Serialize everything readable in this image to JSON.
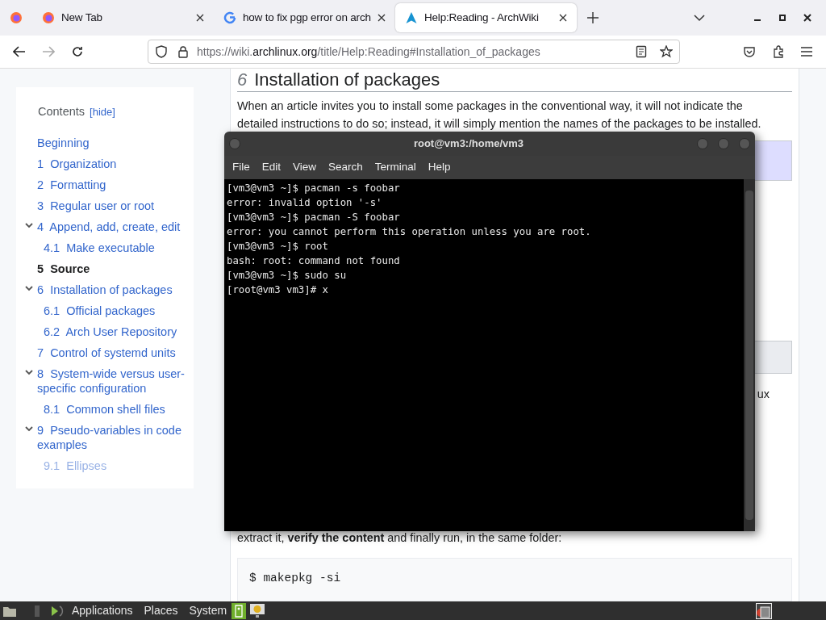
{
  "browser": {
    "tabs": [
      {
        "title": "New Tab",
        "selected": false
      },
      {
        "title": "how to fix pgp error on arch",
        "selected": false
      },
      {
        "title": "Help:Reading - ArchWiki",
        "selected": true
      }
    ],
    "url": {
      "prefix": "https://wiki.",
      "domain": "archlinux.org",
      "suffix": "/title/Help:Reading#Installation_of_packages"
    }
  },
  "toc": {
    "title": "Contents",
    "toggle": "[hide]",
    "items": [
      {
        "label": "Beginning",
        "current": false
      },
      {
        "number": "1",
        "label": "Organization",
        "current": false
      },
      {
        "number": "2",
        "label": "Formatting",
        "current": false
      },
      {
        "number": "3",
        "label": "Regular user or root",
        "current": false
      },
      {
        "number": "4",
        "label": "Append, add, create, edit",
        "current": false,
        "expanded": true,
        "children": [
          {
            "number": "4.1",
            "label": "Make executable",
            "current": false
          }
        ]
      },
      {
        "number": "5",
        "label": "Source",
        "current": true
      },
      {
        "number": "6",
        "label": "Installation of packages",
        "current": false,
        "expanded": true,
        "children": [
          {
            "number": "6.1",
            "label": "Official packages",
            "current": false
          },
          {
            "number": "6.2",
            "label": "Arch User Repository",
            "current": false
          }
        ]
      },
      {
        "number": "7",
        "label": "Control of systemd units",
        "current": false
      },
      {
        "number": "8",
        "label": "System-wide versus user-specific configuration",
        "current": false,
        "expanded": true,
        "children": [
          {
            "number": "8.1",
            "label": "Common shell files",
            "current": false
          }
        ]
      },
      {
        "number": "9",
        "label": "Pseudo-variables in code examples",
        "current": false,
        "expanded": true,
        "children": [
          {
            "number": "9.1",
            "label": "Ellipses",
            "current": false
          }
        ]
      }
    ]
  },
  "article": {
    "heading_number": "6",
    "heading": "Installation of packages",
    "intro": "When an article invites you to install some packages in the conventional way, it will not indicate the detailed instructions to do so; instead, it will simply mention the names of the packages to be installed.",
    "fragment": "ux",
    "aur_line_2": "extract it, **verify the content** and finally run, in the same folder:",
    "code": "$ makepkg -si"
  },
  "terminal": {
    "title": "root@vm3:/home/vm3",
    "menu": [
      "File",
      "Edit",
      "View",
      "Search",
      "Terminal",
      "Help"
    ],
    "lines": [
      "[vm3@vm3 ~]$ pacman -s foobar",
      "error: invalid option '-s'",
      "[vm3@vm3 ~]$ pacman -S foobar",
      "error: you cannot perform this operation unless you are root.",
      "[vm3@vm3 ~]$ root",
      "bash: root: command not found",
      "[vm3@vm3 ~]$ sudo su",
      "[root@vm3 vm3]# x"
    ]
  },
  "taskbar": {
    "menus": [
      "Applications",
      "Places",
      "System"
    ]
  }
}
